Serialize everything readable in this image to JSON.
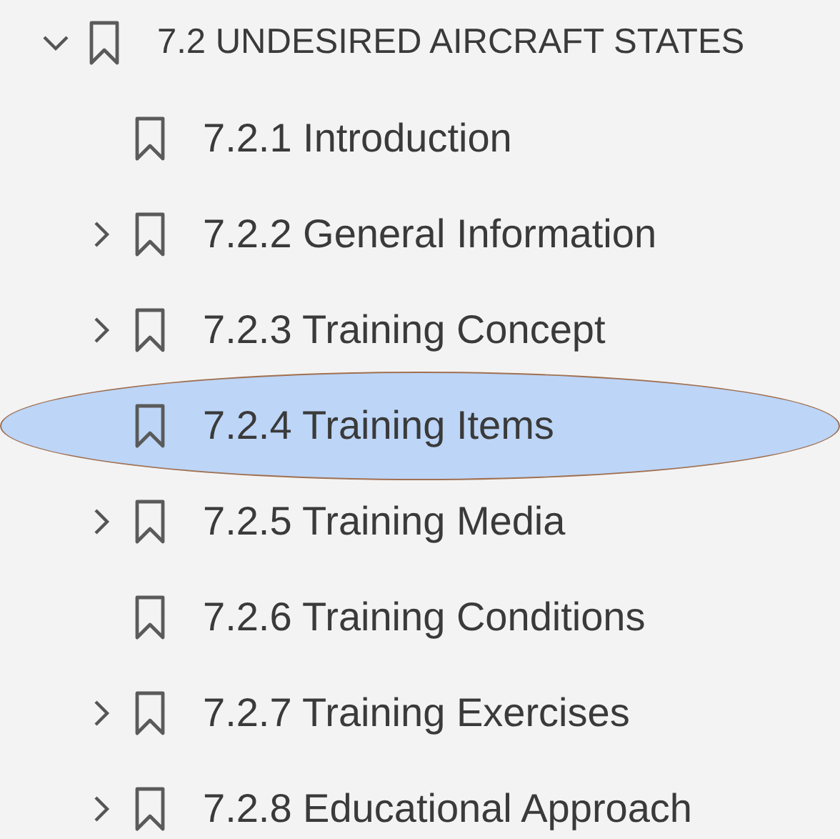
{
  "bookmarks": [
    {
      "label": "7.2 UNDESIRED AIRCRAFT STATES",
      "kind": "folder",
      "expanded": true,
      "selected": false,
      "children": [
        {
          "label": "7.2.1 Introduction",
          "kind": "leaf",
          "selected": false
        },
        {
          "label": "7.2.2 General Information",
          "kind": "folder",
          "expanded": false,
          "selected": false
        },
        {
          "label": "7.2.3 Training Concept",
          "kind": "folder",
          "expanded": false,
          "selected": false
        },
        {
          "label": "7.2.4 Training Items",
          "kind": "leaf",
          "selected": true
        },
        {
          "label": "7.2.5 Training Media",
          "kind": "folder",
          "expanded": false,
          "selected": false
        },
        {
          "label": "7.2.6 Training Conditions",
          "kind": "leaf",
          "selected": false
        },
        {
          "label": "7.2.7 Training Exercises",
          "kind": "folder",
          "expanded": false,
          "selected": false
        },
        {
          "label": "7.2.8 Educational Approach",
          "kind": "folder",
          "expanded": false,
          "selected": false
        }
      ]
    }
  ]
}
